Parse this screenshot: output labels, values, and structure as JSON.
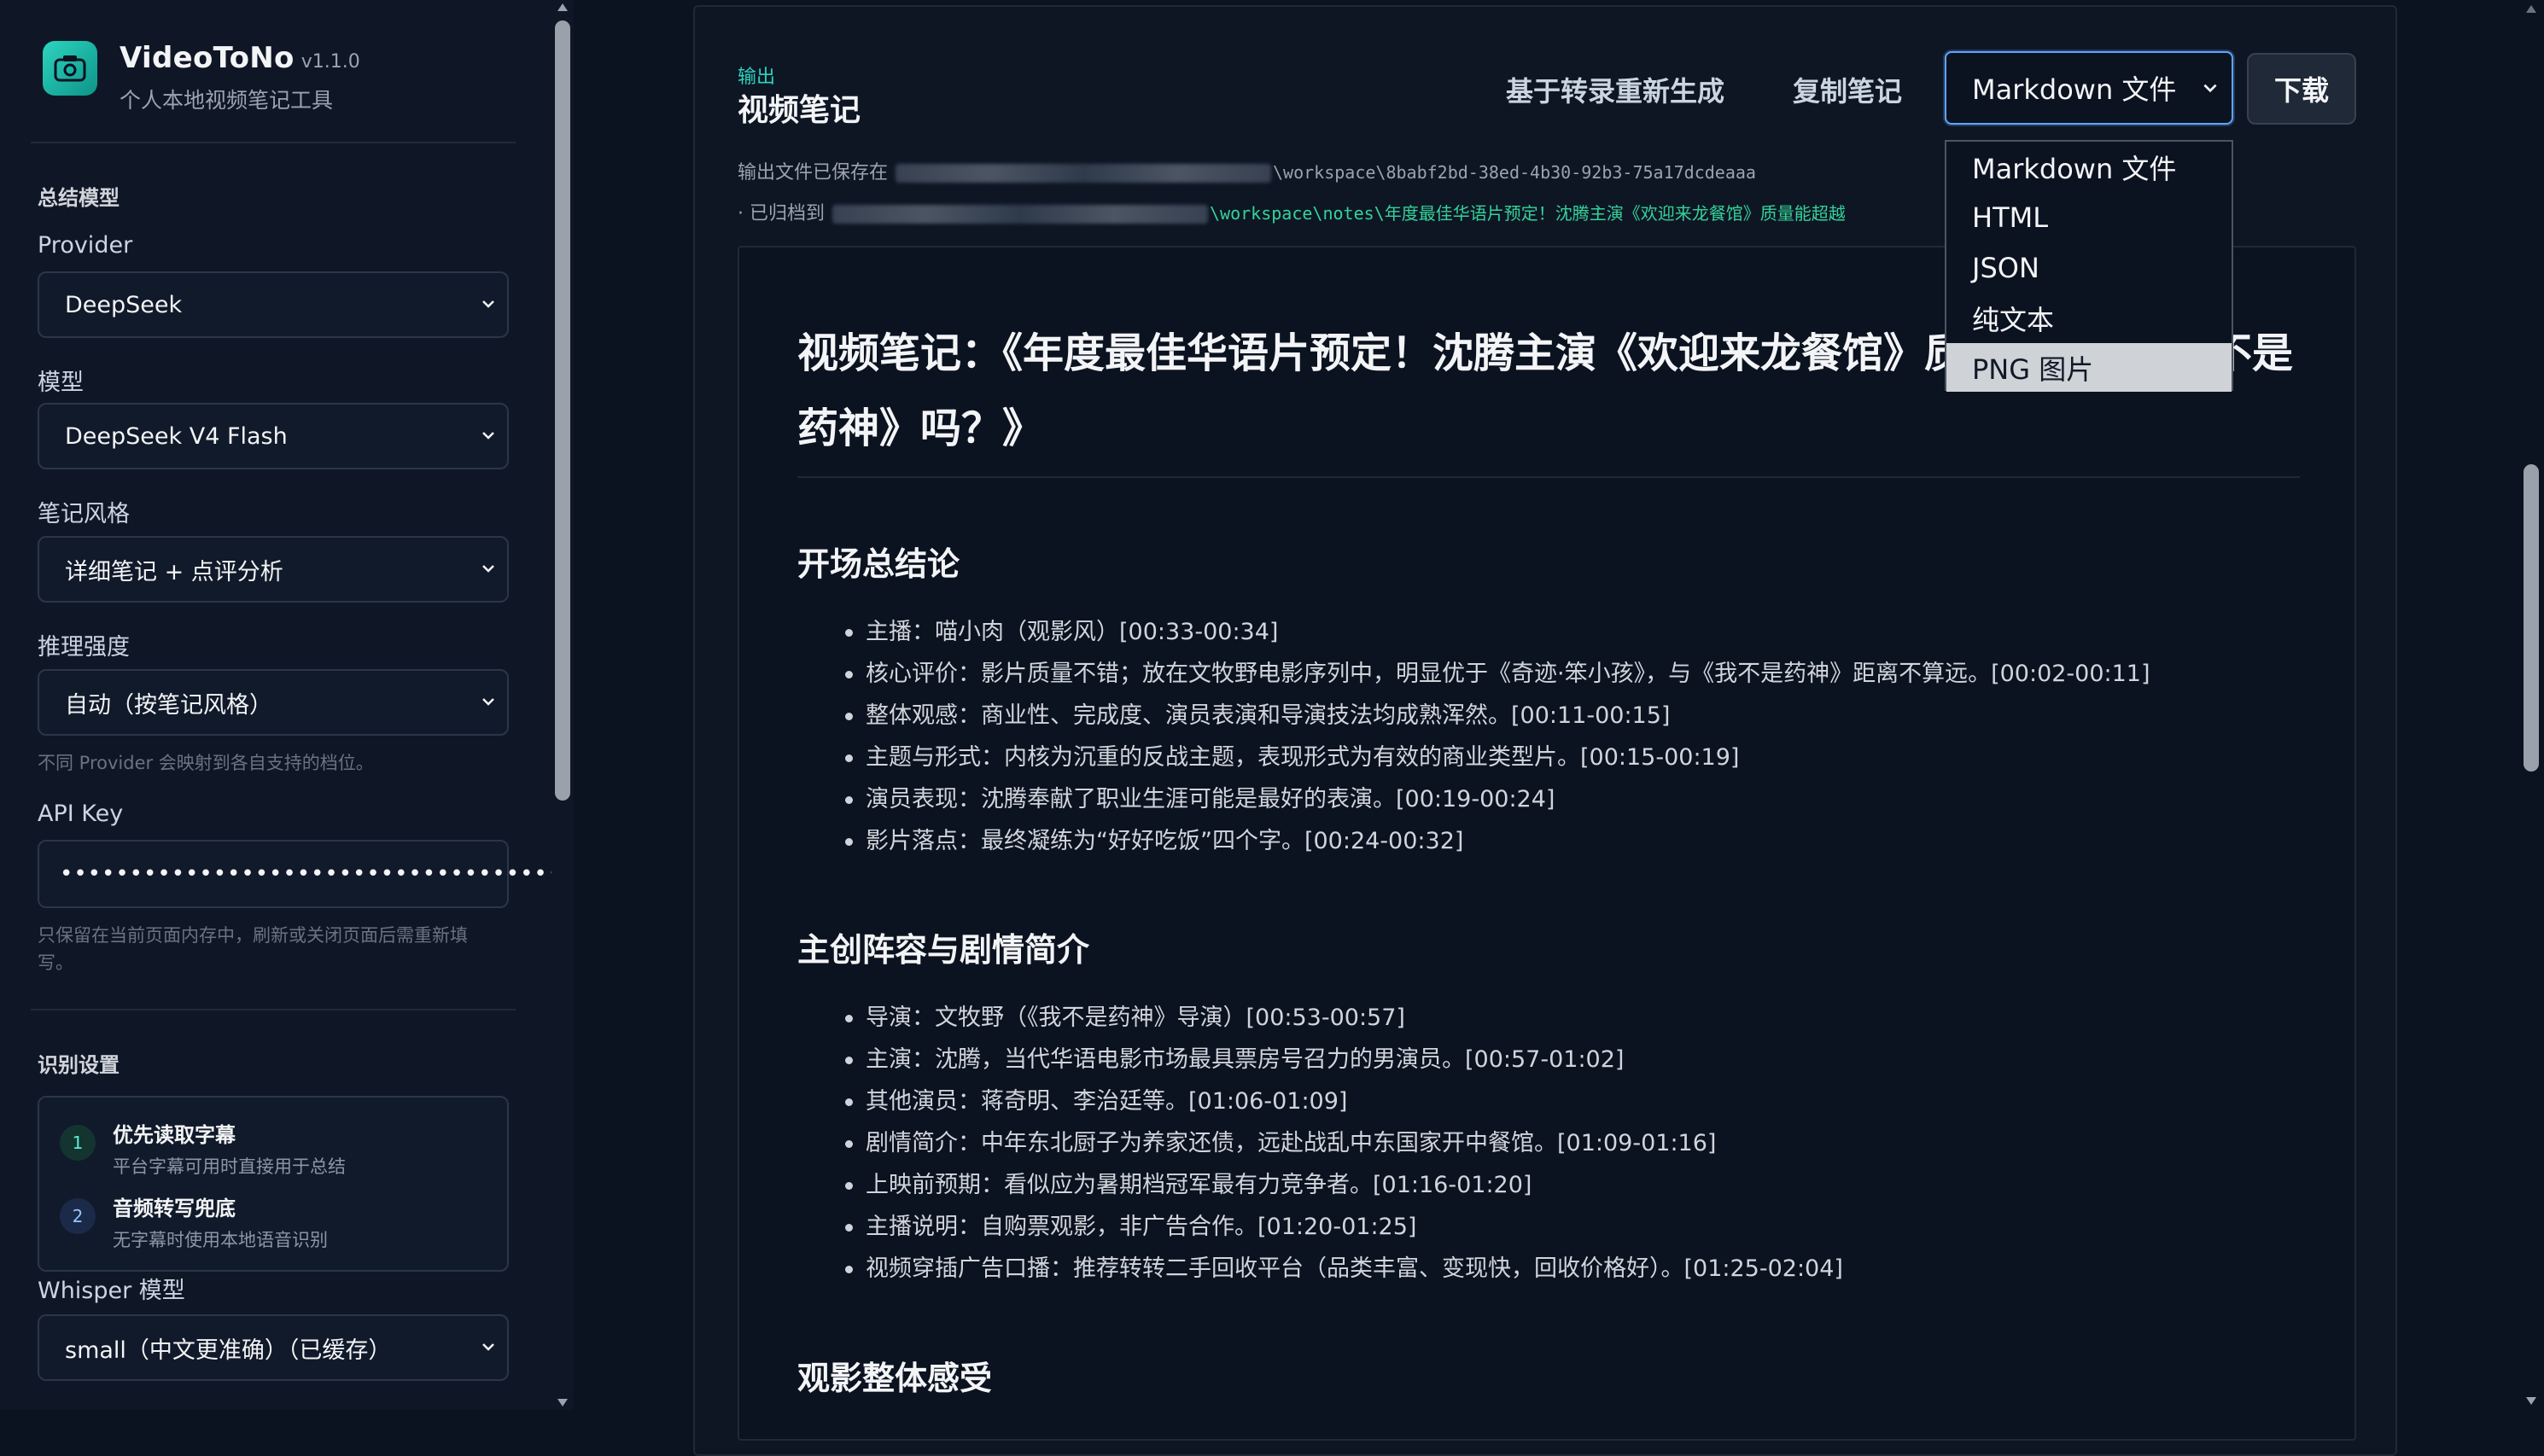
{
  "app": {
    "name": "VideoToNo",
    "version": "v1.1.0",
    "subtitle": "个人本地视频笔记工具",
    "accent": "#2dd4bf"
  },
  "sidebar": {
    "summary_section": "总结模型",
    "provider_label": "Provider",
    "provider_value": "DeepSeek",
    "model_label": "模型",
    "model_value": "DeepSeek V4 Flash",
    "style_label": "笔记风格",
    "style_value": "详细笔记 + 点评分析",
    "reasoning_label": "推理强度",
    "reasoning_value": "自动（按笔记风格）",
    "reasoning_hint": "不同 Provider 会映射到各自支持的档位。",
    "apikey_label": "API Key",
    "apikey_value": "••••••••••••••••••••••••••••••••••••",
    "apikey_hint": "只保留在当前页面内存中，刷新或关闭页面后需重新填写。",
    "recognition_section": "识别设置",
    "steps": [
      {
        "num": "1",
        "title": "优先读取字幕",
        "desc": "平台字幕可用时直接用于总结"
      },
      {
        "num": "2",
        "title": "音频转写兜底",
        "desc": "无字幕时使用本地语音识别"
      }
    ],
    "whisper_label": "Whisper 模型",
    "whisper_value": "small（中文更准确）（已缓存）"
  },
  "output": {
    "label": "输出",
    "title": "视频笔记",
    "regenerate_label": "基于转录重新生成",
    "copy_label": "复制笔记",
    "format_selected": "Markdown 文件",
    "download_label": "下载",
    "saved_prefix": "输出文件已保存在",
    "saved_path": "\\workspace\\8babf2bd-38ed-4b30-92b3-75a17dcdeaaa",
    "archived_prefix": "· 已归档到",
    "archived_path": "\\workspace\\notes\\年度最佳华语片预定！沈腾主演《欢迎来龙餐馆》质量能超越"
  },
  "format_options": [
    {
      "label": "Markdown 文件"
    },
    {
      "label": "HTML"
    },
    {
      "label": "JSON"
    },
    {
      "label": "纯文本"
    },
    {
      "label": "PNG 图片"
    }
  ],
  "note": {
    "title": "视频笔记：《年度最佳华语片预定！沈腾主演《欢迎来龙餐馆》质量能超越《我不是药神》吗？》",
    "sections": [
      {
        "heading": "开场总结论",
        "items": [
          "主播：喵小肉（观影风）[00:33-00:34]",
          "核心评价：影片质量不错；放在文牧野电影序列中，明显优于《奇迹·笨小孩》，与《我不是药神》距离不算远。[00:02-00:11]",
          "整体观感：商业性、完成度、演员表演和导演技法均成熟浑然。[00:11-00:15]",
          "主题与形式：内核为沉重的反战主题，表现形式为有效的商业类型片。[00:15-00:19]",
          "演员表现：沈腾奉献了职业生涯可能是最好的表演。[00:19-00:24]",
          "影片落点：最终凝练为“好好吃饭”四个字。[00:24-00:32]"
        ]
      },
      {
        "heading": "主创阵容与剧情简介",
        "items": [
          "导演：文牧野（《我不是药神》导演）[00:53-00:57]",
          "主演：沈腾，当代华语电影市场最具票房号召力的男演员。[00:57-01:02]",
          "其他演员：蒋奇明、李治廷等。[01:06-01:09]",
          "剧情简介：中年东北厨子为养家还债，远赴战乱中东国家开中餐馆。[01:09-01:16]",
          "上映前预期：看似应为暑期档冠军最有力竞争者。[01:16-01:20]",
          "主播说明：自购票观影，非广告合作。[01:20-01:25]",
          "视频穿插广告口播：推荐转转二手回收平台（品类丰富、变现快，回收价格好）。[01:25-02:04]"
        ]
      },
      {
        "heading": "观影整体感受",
        "items": []
      }
    ]
  }
}
